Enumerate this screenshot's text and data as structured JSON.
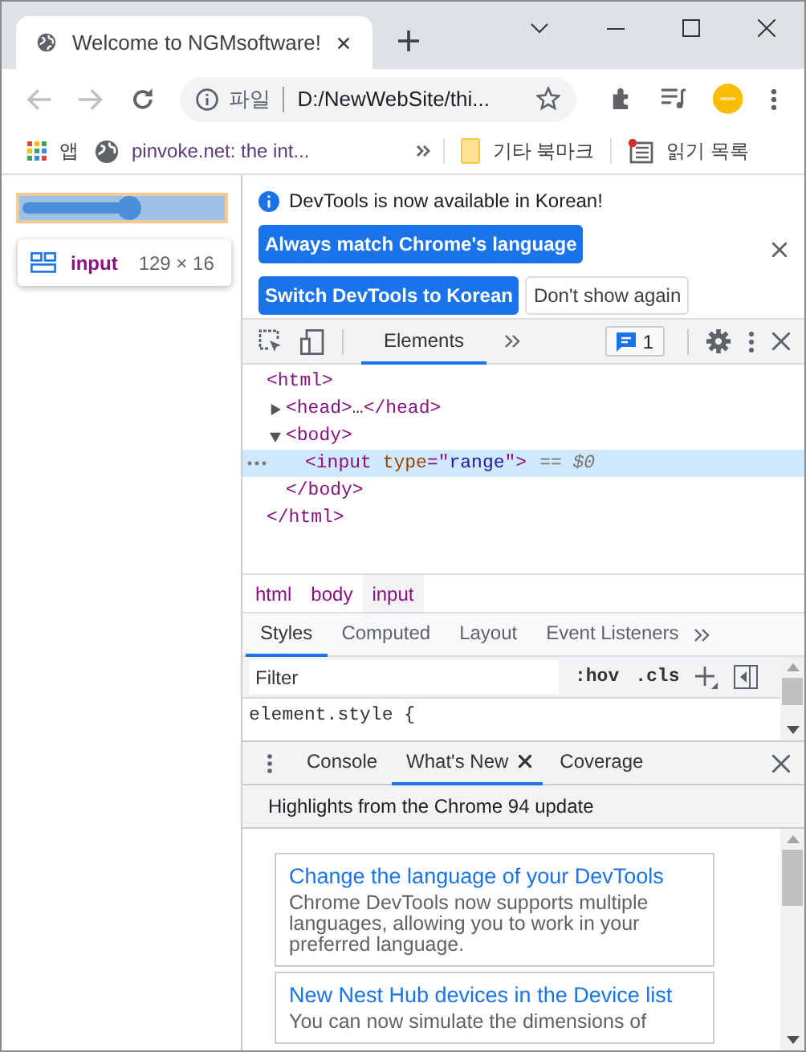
{
  "browser": {
    "tab": {
      "title": "Welcome to NGMsoftware!"
    },
    "address": {
      "scheme": "파일",
      "url": "D:/NewWebSite/thi..."
    },
    "bookmarks": [
      {
        "label": "앱",
        "kind": "apps"
      },
      {
        "label": "pinvoke.net: the int...",
        "kind": "site"
      }
    ],
    "other_bookmarks": "기타 북마크",
    "reading_list": "읽기 목록"
  },
  "page": {
    "slider": {
      "level": 0.53
    },
    "tooltip": {
      "tag": "input",
      "size": "129 × 16"
    }
  },
  "devtools": {
    "infobar": {
      "message": "DevTools is now available in Korean!",
      "buttons": [
        {
          "label": "Always match Chrome's language",
          "kind": "primary"
        },
        {
          "label": "Switch DevTools to Korean",
          "kind": "primary"
        },
        {
          "label": "Don't show again",
          "kind": "secondary"
        }
      ]
    },
    "panel_tabs": [
      {
        "label": "Elements",
        "selected": true
      }
    ],
    "issues": "1",
    "dom": [
      {
        "tokens": [
          {
            "text": "<html>",
            "kind": "tag"
          }
        ],
        "close": "</html>",
        "selected": false,
        "children": [
          {
            "tokens": [
              {
                "text": "<head>",
                "kind": "tag"
              },
              {
                "text": "…",
                "kind": "text"
              },
              {
                "text": "</head>",
                "kind": "tag"
              }
            ],
            "expanded": false,
            "selected": false
          },
          {
            "tokens": [
              {
                "text": "<body>",
                "kind": "tag"
              }
            ],
            "close": "</body>",
            "expanded": true,
            "selected": false,
            "children": [
              {
                "tokens": [
                  {
                    "text": "<input",
                    "kind": "tag"
                  },
                  {
                    "text": " type",
                    "kind": "attr"
                  },
                  {
                    "text": "=\"",
                    "kind": "punct"
                  },
                  {
                    "text": "range",
                    "kind": "value"
                  },
                  {
                    "text": "\">",
                    "kind": "tag"
                  }
                ],
                "marker": "== $0",
                "selected": true
              }
            ]
          }
        ]
      }
    ],
    "breadcrumbs": [
      {
        "label": "html",
        "selected": false
      },
      {
        "label": "body",
        "selected": false
      },
      {
        "label": "input",
        "selected": true
      }
    ],
    "style_tabs": [
      {
        "label": "Styles",
        "selected": true
      },
      {
        "label": "Computed",
        "selected": false
      },
      {
        "label": "Layout",
        "selected": false
      },
      {
        "label": "Event Listeners",
        "selected": false
      }
    ],
    "filter": {
      "placeholder": "Filter"
    },
    "hov": ":hov",
    "cls": ".cls",
    "rule": "element.style {",
    "drawer_tabs": [
      {
        "label": "Console",
        "selected": false,
        "closable": false
      },
      {
        "label": "What's New",
        "selected": true,
        "closable": true
      },
      {
        "label": "Coverage",
        "selected": false,
        "closable": false
      }
    ],
    "whats_new": {
      "header": "Highlights from the Chrome 94 update",
      "cards": [
        {
          "title": "Change the language of your DevTools",
          "body": "Chrome DevTools now supports multiple languages, allowing you to work in your preferred language."
        },
        {
          "title": "New Nest Hub devices in the Device list",
          "body": "You can now simulate the dimensions of"
        }
      ]
    }
  }
}
